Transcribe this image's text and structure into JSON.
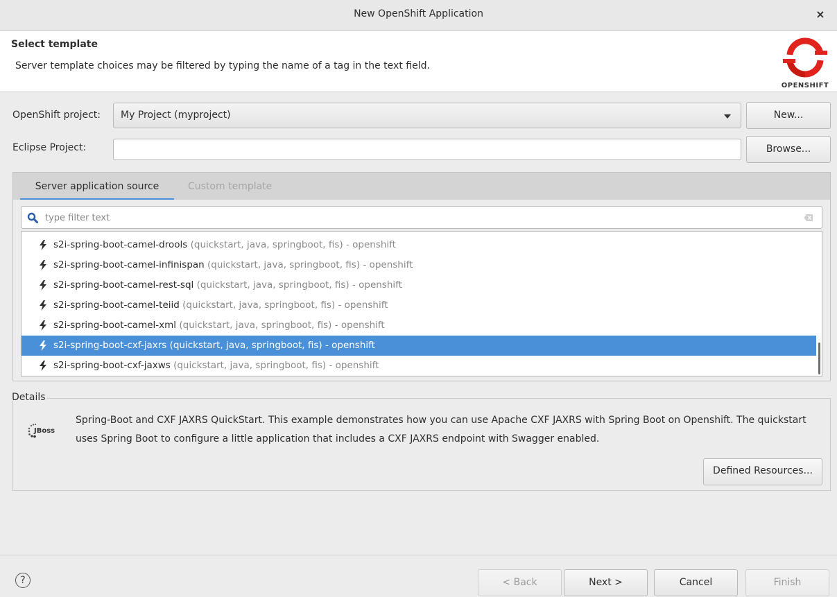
{
  "window": {
    "title": "New OpenShift Application",
    "close_glyph": "×"
  },
  "header": {
    "title": "Select template",
    "description": "Server template choices may be filtered by typing the name of a tag in the text field.",
    "logo_caption": "OPENSHIFT",
    "logo_icon": "openshift-logo-icon"
  },
  "project": {
    "label": "OpenShift project:",
    "selected": "My Project (myproject)",
    "new_button": "New..."
  },
  "eclipse": {
    "label": "Eclipse Project:",
    "value": "",
    "browse_button": "Browse..."
  },
  "tabs": [
    {
      "label": "Server application source",
      "active": true
    },
    {
      "label": "Custom template",
      "active": false
    }
  ],
  "filter": {
    "placeholder": "type filter text",
    "value": ""
  },
  "templates": [
    {
      "name": "s2i-spring-boot-camel-drools",
      "tags": " (quickstart, java, springboot, fis) - openshift",
      "selected": false
    },
    {
      "name": "s2i-spring-boot-camel-infinispan",
      "tags": " (quickstart, java, springboot, fis) - openshift",
      "selected": false
    },
    {
      "name": "s2i-spring-boot-camel-rest-sql",
      "tags": " (quickstart, java, springboot, fis) - openshift",
      "selected": false
    },
    {
      "name": "s2i-spring-boot-camel-teiid",
      "tags": " (quickstart, java, springboot, fis) - openshift",
      "selected": false
    },
    {
      "name": "s2i-spring-boot-camel-xml",
      "tags": " (quickstart, java, springboot, fis) - openshift",
      "selected": false
    },
    {
      "name": "s2i-spring-boot-cxf-jaxrs",
      "tags": " (quickstart, java, springboot, fis) - openshift",
      "selected": true
    },
    {
      "name": "s2i-spring-boot-cxf-jaxws",
      "tags": " (quickstart, java, springboot, fis) - openshift",
      "selected": false
    }
  ],
  "details": {
    "label": "Details",
    "logo_text": "JBoss",
    "text": "Spring-Boot and CXF JAXRS QuickStart. This example demonstrates how you can use Apache CXF JAXRS with Spring Boot on Openshift. The quickstart uses Spring Boot to configure a little application that includes a CXF JAXRS endpoint with Swagger enabled.",
    "defined_resources_button": "Defined Resources..."
  },
  "footer": {
    "help_glyph": "?",
    "back": "< Back",
    "next": "Next >",
    "cancel": "Cancel",
    "finish": "Finish"
  },
  "colors": {
    "selection": "#4a90d9",
    "openshift_red": "#e0231c"
  }
}
